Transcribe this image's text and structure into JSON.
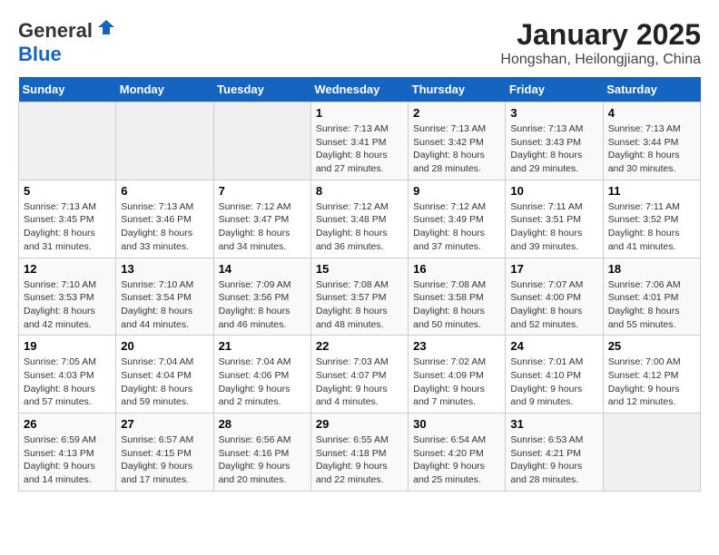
{
  "header": {
    "logo_general": "General",
    "logo_blue": "Blue",
    "title": "January 2025",
    "subtitle": "Hongshan, Heilongjiang, China"
  },
  "days_of_week": [
    "Sunday",
    "Monday",
    "Tuesday",
    "Wednesday",
    "Thursday",
    "Friday",
    "Saturday"
  ],
  "weeks": [
    [
      {
        "day": "",
        "info": ""
      },
      {
        "day": "",
        "info": ""
      },
      {
        "day": "",
        "info": ""
      },
      {
        "day": "1",
        "info": "Sunrise: 7:13 AM\nSunset: 3:41 PM\nDaylight: 8 hours and 27 minutes."
      },
      {
        "day": "2",
        "info": "Sunrise: 7:13 AM\nSunset: 3:42 PM\nDaylight: 8 hours and 28 minutes."
      },
      {
        "day": "3",
        "info": "Sunrise: 7:13 AM\nSunset: 3:43 PM\nDaylight: 8 hours and 29 minutes."
      },
      {
        "day": "4",
        "info": "Sunrise: 7:13 AM\nSunset: 3:44 PM\nDaylight: 8 hours and 30 minutes."
      }
    ],
    [
      {
        "day": "5",
        "info": "Sunrise: 7:13 AM\nSunset: 3:45 PM\nDaylight: 8 hours and 31 minutes."
      },
      {
        "day": "6",
        "info": "Sunrise: 7:13 AM\nSunset: 3:46 PM\nDaylight: 8 hours and 33 minutes."
      },
      {
        "day": "7",
        "info": "Sunrise: 7:12 AM\nSunset: 3:47 PM\nDaylight: 8 hours and 34 minutes."
      },
      {
        "day": "8",
        "info": "Sunrise: 7:12 AM\nSunset: 3:48 PM\nDaylight: 8 hours and 36 minutes."
      },
      {
        "day": "9",
        "info": "Sunrise: 7:12 AM\nSunset: 3:49 PM\nDaylight: 8 hours and 37 minutes."
      },
      {
        "day": "10",
        "info": "Sunrise: 7:11 AM\nSunset: 3:51 PM\nDaylight: 8 hours and 39 minutes."
      },
      {
        "day": "11",
        "info": "Sunrise: 7:11 AM\nSunset: 3:52 PM\nDaylight: 8 hours and 41 minutes."
      }
    ],
    [
      {
        "day": "12",
        "info": "Sunrise: 7:10 AM\nSunset: 3:53 PM\nDaylight: 8 hours and 42 minutes."
      },
      {
        "day": "13",
        "info": "Sunrise: 7:10 AM\nSunset: 3:54 PM\nDaylight: 8 hours and 44 minutes."
      },
      {
        "day": "14",
        "info": "Sunrise: 7:09 AM\nSunset: 3:56 PM\nDaylight: 8 hours and 46 minutes."
      },
      {
        "day": "15",
        "info": "Sunrise: 7:08 AM\nSunset: 3:57 PM\nDaylight: 8 hours and 48 minutes."
      },
      {
        "day": "16",
        "info": "Sunrise: 7:08 AM\nSunset: 3:58 PM\nDaylight: 8 hours and 50 minutes."
      },
      {
        "day": "17",
        "info": "Sunrise: 7:07 AM\nSunset: 4:00 PM\nDaylight: 8 hours and 52 minutes."
      },
      {
        "day": "18",
        "info": "Sunrise: 7:06 AM\nSunset: 4:01 PM\nDaylight: 8 hours and 55 minutes."
      }
    ],
    [
      {
        "day": "19",
        "info": "Sunrise: 7:05 AM\nSunset: 4:03 PM\nDaylight: 8 hours and 57 minutes."
      },
      {
        "day": "20",
        "info": "Sunrise: 7:04 AM\nSunset: 4:04 PM\nDaylight: 8 hours and 59 minutes."
      },
      {
        "day": "21",
        "info": "Sunrise: 7:04 AM\nSunset: 4:06 PM\nDaylight: 9 hours and 2 minutes."
      },
      {
        "day": "22",
        "info": "Sunrise: 7:03 AM\nSunset: 4:07 PM\nDaylight: 9 hours and 4 minutes."
      },
      {
        "day": "23",
        "info": "Sunrise: 7:02 AM\nSunset: 4:09 PM\nDaylight: 9 hours and 7 minutes."
      },
      {
        "day": "24",
        "info": "Sunrise: 7:01 AM\nSunset: 4:10 PM\nDaylight: 9 hours and 9 minutes."
      },
      {
        "day": "25",
        "info": "Sunrise: 7:00 AM\nSunset: 4:12 PM\nDaylight: 9 hours and 12 minutes."
      }
    ],
    [
      {
        "day": "26",
        "info": "Sunrise: 6:59 AM\nSunset: 4:13 PM\nDaylight: 9 hours and 14 minutes."
      },
      {
        "day": "27",
        "info": "Sunrise: 6:57 AM\nSunset: 4:15 PM\nDaylight: 9 hours and 17 minutes."
      },
      {
        "day": "28",
        "info": "Sunrise: 6:56 AM\nSunset: 4:16 PM\nDaylight: 9 hours and 20 minutes."
      },
      {
        "day": "29",
        "info": "Sunrise: 6:55 AM\nSunset: 4:18 PM\nDaylight: 9 hours and 22 minutes."
      },
      {
        "day": "30",
        "info": "Sunrise: 6:54 AM\nSunset: 4:20 PM\nDaylight: 9 hours and 25 minutes."
      },
      {
        "day": "31",
        "info": "Sunrise: 6:53 AM\nSunset: 4:21 PM\nDaylight: 9 hours and 28 minutes."
      },
      {
        "day": "",
        "info": ""
      }
    ]
  ]
}
